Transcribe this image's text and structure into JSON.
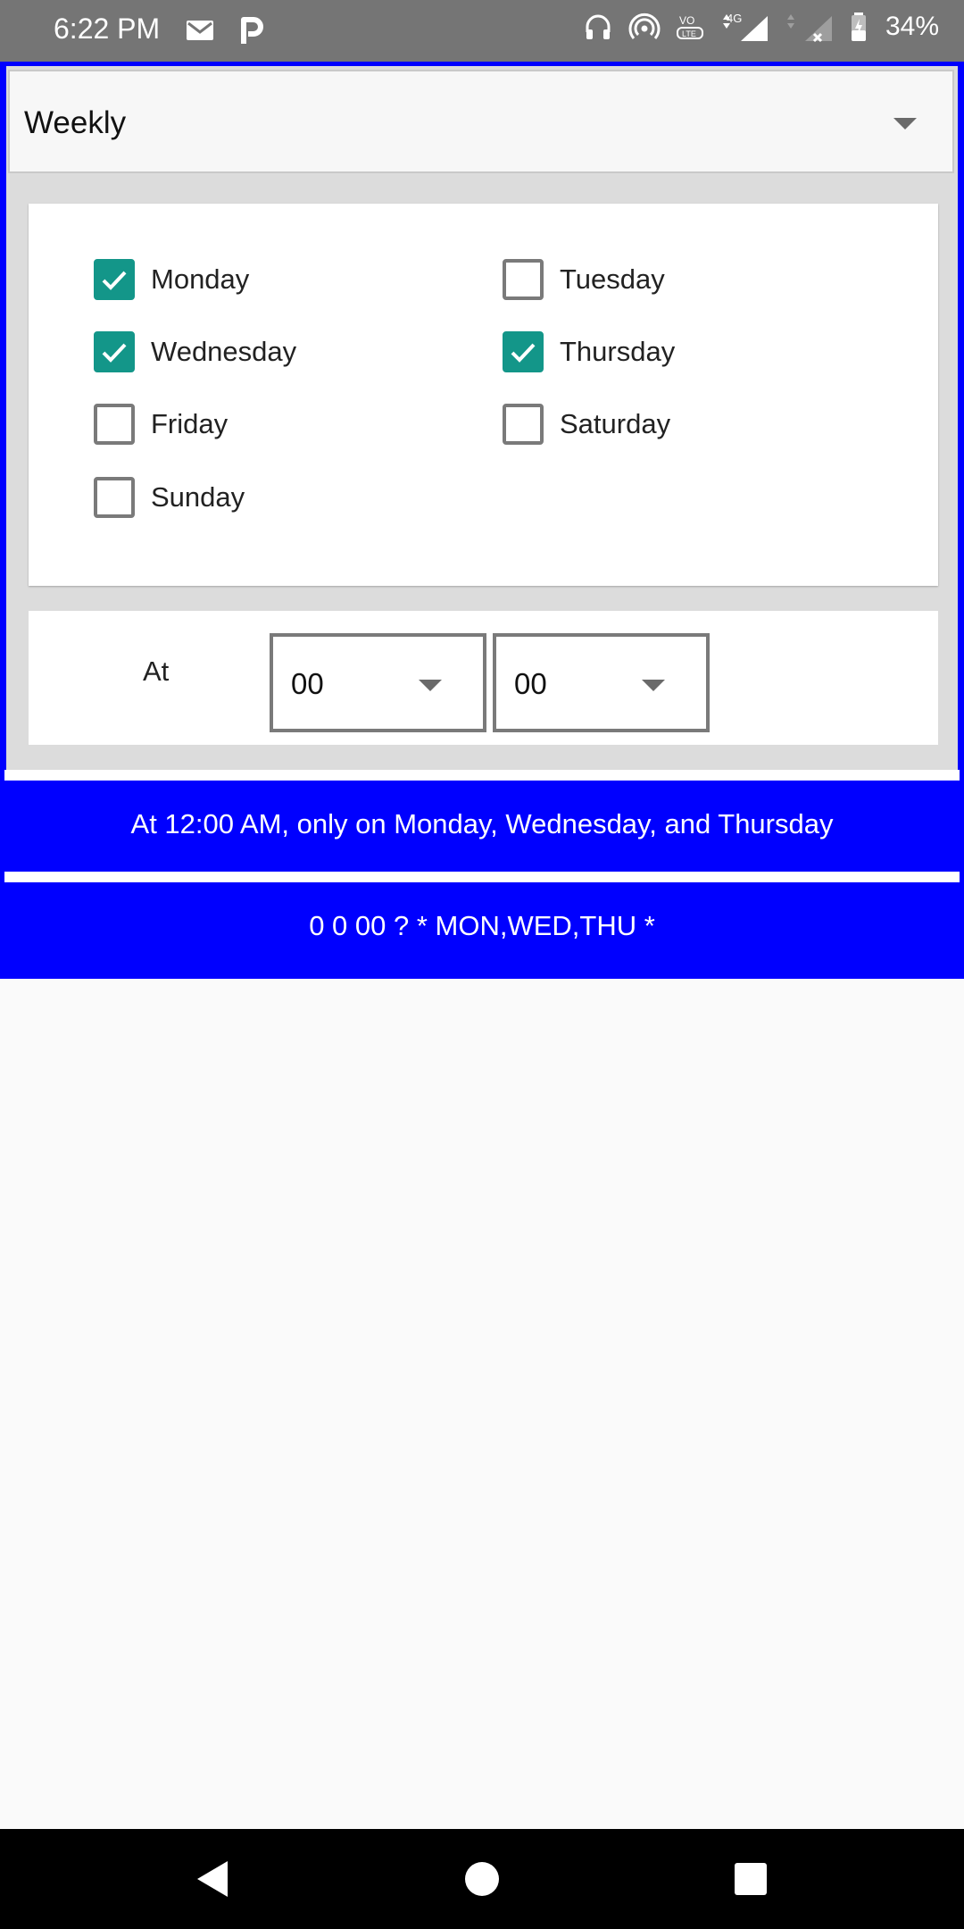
{
  "status_bar": {
    "time": "6:22 PM",
    "left_icons": [
      "gmail-icon",
      "p-app-icon"
    ],
    "right_icons": [
      "headset-icon",
      "hotspot-icon",
      "volte-icon",
      "signal-4g-icon",
      "signal-no-sim-icon",
      "battery-charging-icon"
    ],
    "network_label": "4G",
    "battery": "34%"
  },
  "frequency": {
    "selected": "Weekly"
  },
  "days": [
    {
      "label": "Monday",
      "checked": true
    },
    {
      "label": "Tuesday",
      "checked": false
    },
    {
      "label": "Wednesday",
      "checked": true
    },
    {
      "label": "Thursday",
      "checked": true
    },
    {
      "label": "Friday",
      "checked": false
    },
    {
      "label": "Saturday",
      "checked": false
    },
    {
      "label": "Sunday",
      "checked": false
    }
  ],
  "time": {
    "at_label": "At",
    "hour": "00",
    "minute": "00"
  },
  "summary": {
    "description": "At 12:00 AM, only on Monday, Wednesday, and Thursday",
    "cron": "0 0 00 ? * MON,WED,THU *"
  },
  "colors": {
    "accent_blue": "#0000ff",
    "checkbox_teal": "#139689",
    "status_bar": "#757575"
  },
  "nav_bar": {
    "buttons": [
      "back-icon",
      "home-icon",
      "recents-icon"
    ]
  }
}
